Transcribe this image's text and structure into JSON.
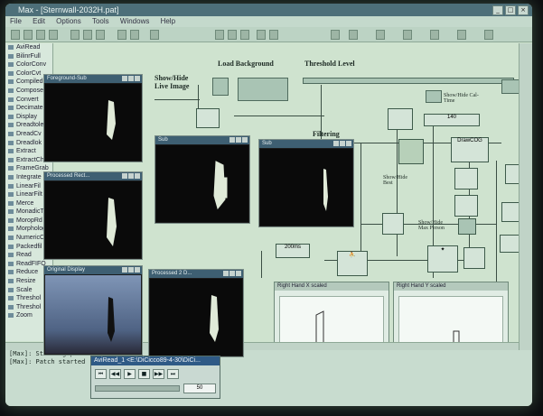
{
  "app": {
    "title": "Max - [Sternwall-2032H.pat]",
    "menu": [
      "File",
      "Edit",
      "Options",
      "Tools",
      "Windows",
      "Help"
    ]
  },
  "sidebar": {
    "items": [
      "AviRead",
      "BilinrFull",
      "ColorConv",
      "ColorCvt",
      "Compiled",
      "Compose",
      "Convert",
      "Decimate",
      "Display",
      "Dreadtole",
      "DreadCv",
      "Dreadlok",
      "Extract",
      "ExtractCh",
      "FrameGrab",
      "Integrate",
      "LinearFil",
      "LinearFilt",
      "Merce",
      "MonadicT",
      "MoropRd",
      "Morphology",
      "NumericC",
      "Packedfil",
      "Read",
      "ReadFIFO",
      "Reduce",
      "Resize",
      "Scale",
      "Threshol",
      "Threshol",
      "Zoom"
    ]
  },
  "canvas": {
    "labels": {
      "show_hide_live": "Show/Hide\nLive Image",
      "load_background": "Load Background",
      "threshold_level": "Threshold Level",
      "filtering": "Filtering",
      "show_hide_cal": "Show/Hide Cal-\nTime",
      "show_hide_best": "Show/Hide\nBest",
      "show_hide_max": "Show/Hide\nMax Person",
      "pct_num": "140",
      "num_200": "200ms",
      "draw_coq": "DrawCOG"
    }
  },
  "windows": [
    {
      "title": "Foreground-Sub",
      "key": "w1"
    },
    {
      "title": "Processed Rect...",
      "key": "w2"
    },
    {
      "title": "Original Display",
      "key": "w3"
    },
    {
      "title": "Sub",
      "key": "w4"
    },
    {
      "title": "Sub",
      "key": "w5"
    },
    {
      "title": "Processed 2 D...",
      "key": "w6"
    }
  ],
  "graphs": [
    {
      "title": "Right Hand X scaled"
    },
    {
      "title": "Right Hand Y scaled"
    }
  ],
  "status": {
    "lines": [
      "[Max]: Starting patch",
      "[Max]: Patch started"
    ]
  },
  "avireader": {
    "title": "AviRead_1 <E:\\DiCicco89-4-30\\DiCi...",
    "frame": "50",
    "controls": [
      "⏮",
      "◀◀",
      "▶",
      "■",
      "▶▶",
      "⏭"
    ]
  },
  "colors": {
    "screen_bg": "#cfe3cf",
    "titlebar": "#4d6f79",
    "window_titlebar": "#3e5f72"
  }
}
